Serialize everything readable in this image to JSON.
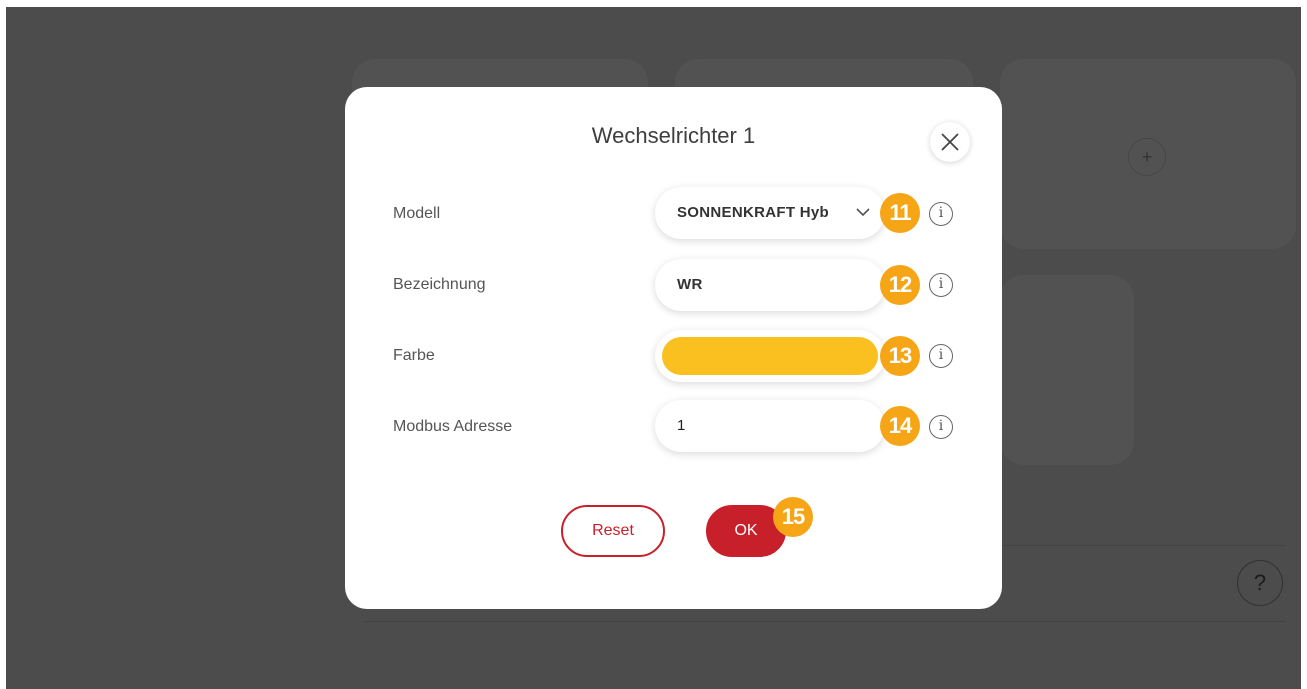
{
  "background": {
    "add_symbol": "+",
    "help_symbol": "?"
  },
  "dialog": {
    "title": "Wechselrichter 1",
    "close_icon": "close-icon",
    "rows": [
      {
        "label": "Modell",
        "value": "SONNENKRAFT Hyb",
        "badge": "11"
      },
      {
        "label": "Bezeichnung",
        "value": "WR",
        "badge": "12"
      },
      {
        "label": "Farbe",
        "color": "#f9c01f",
        "badge": "13"
      },
      {
        "label": "Modbus Adresse",
        "value": "1",
        "badge": "14"
      }
    ],
    "info_symbol": "i",
    "buttons": {
      "reset": "Reset",
      "ok": "OK",
      "ok_badge": "15"
    }
  },
  "colors": {
    "accent_red": "#c8202a",
    "badge_orange": "#f5a516",
    "farbe_swatch": "#f9c01f"
  }
}
